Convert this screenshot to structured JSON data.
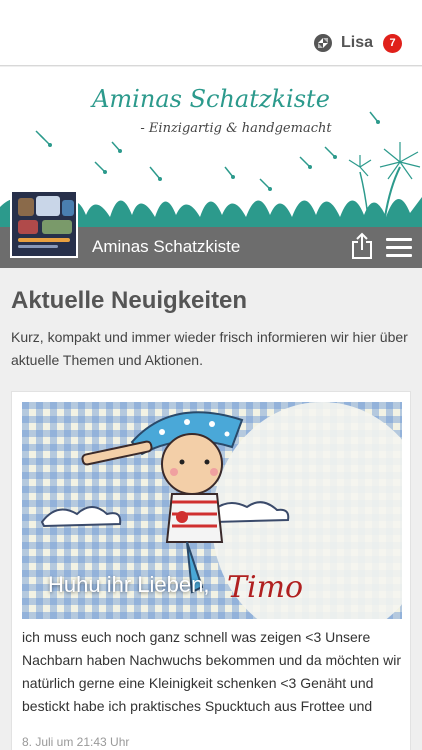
{
  "user": {
    "name": "Lisa",
    "notification_count": "7",
    "icon": "app-logo-icon"
  },
  "banner": {
    "title": "Aminas Schatzkiste",
    "subtitle": "- Einzigartig & handgemacht"
  },
  "titlebar": {
    "shop_name": "Aminas Schatzkiste",
    "share_icon": "share-icon",
    "menu_icon": "hamburger-menu-icon"
  },
  "colors": {
    "accent": "#2c9a8c",
    "badge": "#e0201a",
    "titlebar": "#6d6d6d"
  },
  "news": {
    "heading": "Aktuelle Neuigkeiten",
    "description": "Kurz, kompakt und immer wieder frisch informieren wir hier über aktuelle Themen und Aktionen.",
    "post": {
      "image_title": "Huhu ihr Lieben,",
      "text": "ich muss euch noch ganz schnell was zeigen <3 Unsere Nachbarn haben Nachwuchs bekommen und da möchten wir natürlich gerne eine Kleinigkeit schenken <3 Genäht und bestickt habe ich praktisches Spucktuch aus Frottee und",
      "date": "8. Juli um 21:43 Uhr"
    }
  }
}
